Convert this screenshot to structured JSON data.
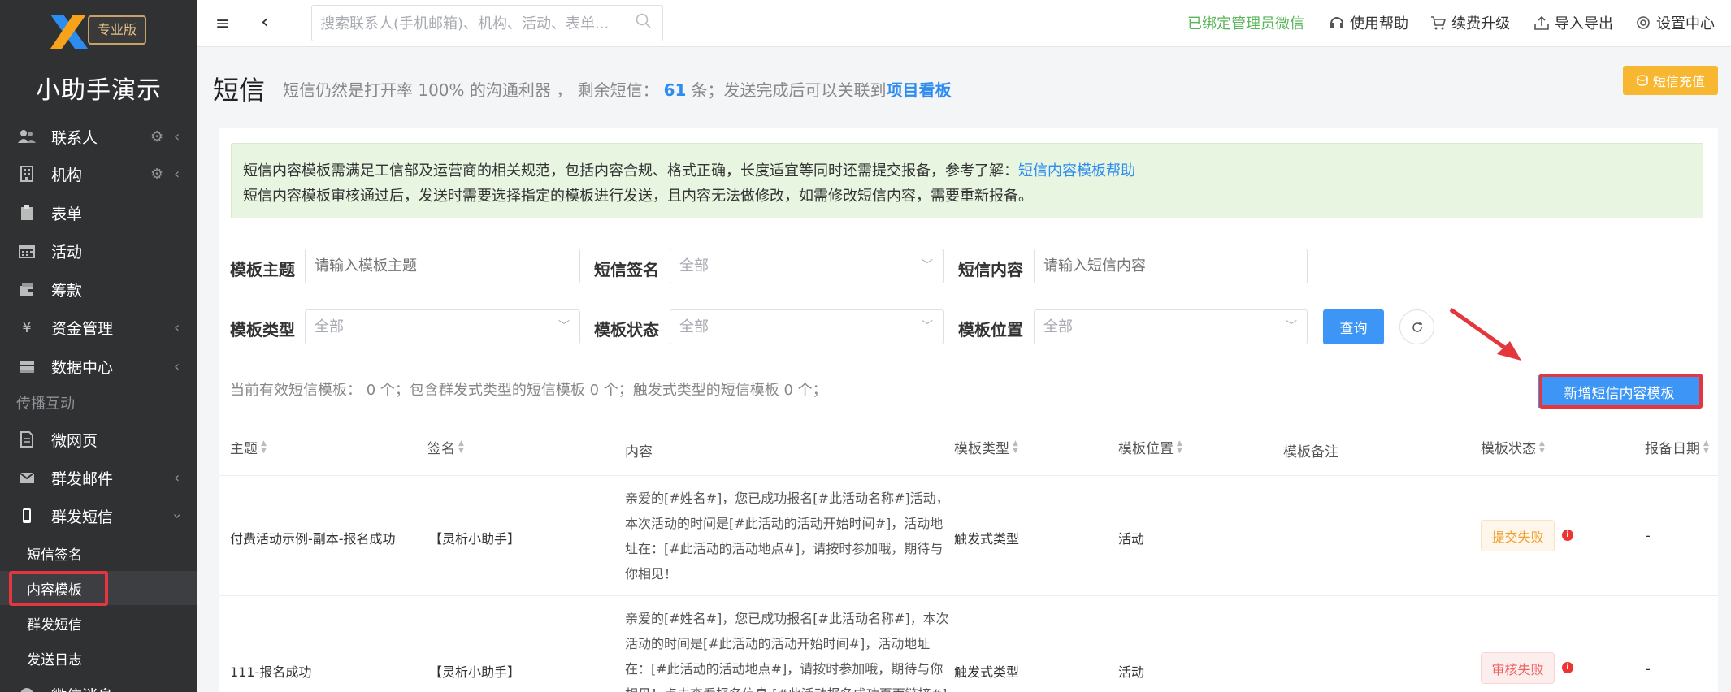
{
  "sidebar": {
    "logo_badge": "专业版",
    "app_name": "小助手演示",
    "items": [
      {
        "label": "联系人",
        "icon": "contacts-icon"
      },
      {
        "label": "机构",
        "icon": "building-icon"
      },
      {
        "label": "表单",
        "icon": "clipboard-icon"
      },
      {
        "label": "活动",
        "icon": "calendar-icon"
      },
      {
        "label": "筹款",
        "icon": "wallet-icon"
      },
      {
        "label": "资金管理",
        "icon": "yen-icon"
      },
      {
        "label": "数据中心",
        "icon": "stack-icon"
      }
    ],
    "section_label": "传播互动",
    "items2": [
      {
        "label": "微网页",
        "icon": "document-icon"
      },
      {
        "label": "群发邮件",
        "icon": "mail-icon"
      },
      {
        "label": "群发短信",
        "icon": "phone-icon"
      }
    ],
    "sub_items": [
      "短信签名",
      "内容模板",
      "群发短信",
      "发送日志"
    ],
    "partial_item": "微信消息"
  },
  "topbar": {
    "search_placeholder": "搜索联系人(手机邮箱)、机构、活动、表单...",
    "links": [
      "已绑定管理员微信",
      "使用帮助",
      "续费升级",
      "导入导出",
      "设置中心"
    ]
  },
  "page": {
    "title": "短信",
    "subtitle_prefix": "短信仍然是打开率 100% 的沟通利器 ， 剩余短信：",
    "sms_remaining": "61",
    "subtitle_mid": "条；发送完成后可以关联到",
    "subtitle_link": "项目看板",
    "recharge_label": "短信充值"
  },
  "notice": {
    "line1": "短信内容模板需满足工信部及运营商的相关规范，包括内容合规、格式正确，长度适宜等同时还需提交报备，参考了解：",
    "line1_link": "短信内容模板帮助",
    "line2": "短信内容模板审核通过后，发送时需要选择指定的模板进行发送，且内容无法做修改，如需修改短信内容，需要重新报备。"
  },
  "filters": {
    "subject_label": "模板主题",
    "subject_placeholder": "请输入模板主题",
    "signature_label": "短信签名",
    "signature_value": "全部",
    "content_label": "短信内容",
    "content_placeholder": "请输入短信内容",
    "type_label": "模板类型",
    "type_value": "全部",
    "status_label": "模板状态",
    "status_value": "全部",
    "position_label": "模板位置",
    "position_value": "全部",
    "query_label": "查询"
  },
  "stats_text": "当前有效短信模板： 0 个；包含群发式类型的短信模板 0 个；触发式类型的短信模板 0 个；",
  "add_button_label": "新增短信内容模板",
  "table": {
    "headers": [
      "主题",
      "签名",
      "内容",
      "模板类型",
      "模板位置",
      "模板备注",
      "模板状态",
      "报备日期"
    ],
    "rows": [
      {
        "subject": "付费活动示例-副本-报名成功",
        "signature": "【灵析小助手】",
        "content": "亲爱的[#姓名#]，您已成功报名[#此活动名称#]活动，本次活动的时间是[#此活动的活动开始时间#]，活动地址在：[#此活动的活动地点#]，请按时参加哦，期待与你相见！",
        "type": "触发式类型",
        "position": "活动",
        "status": "提交失败",
        "date": "-"
      },
      {
        "subject": "111-报名成功",
        "signature": "【灵析小助手】",
        "content": "亲爱的[#姓名#]，您已成功报名[#此活动名称#]，本次活动的时间是[#此活动的活动开始时间#]，活动地址在：[#此活动的活动地点#]，请按时参加哦，期待与你相见！点击查看报名信息 [#此活动报名成功页面链接#]",
        "type": "触发式类型",
        "position": "活动",
        "status": "审核失败",
        "date": "-"
      }
    ]
  }
}
